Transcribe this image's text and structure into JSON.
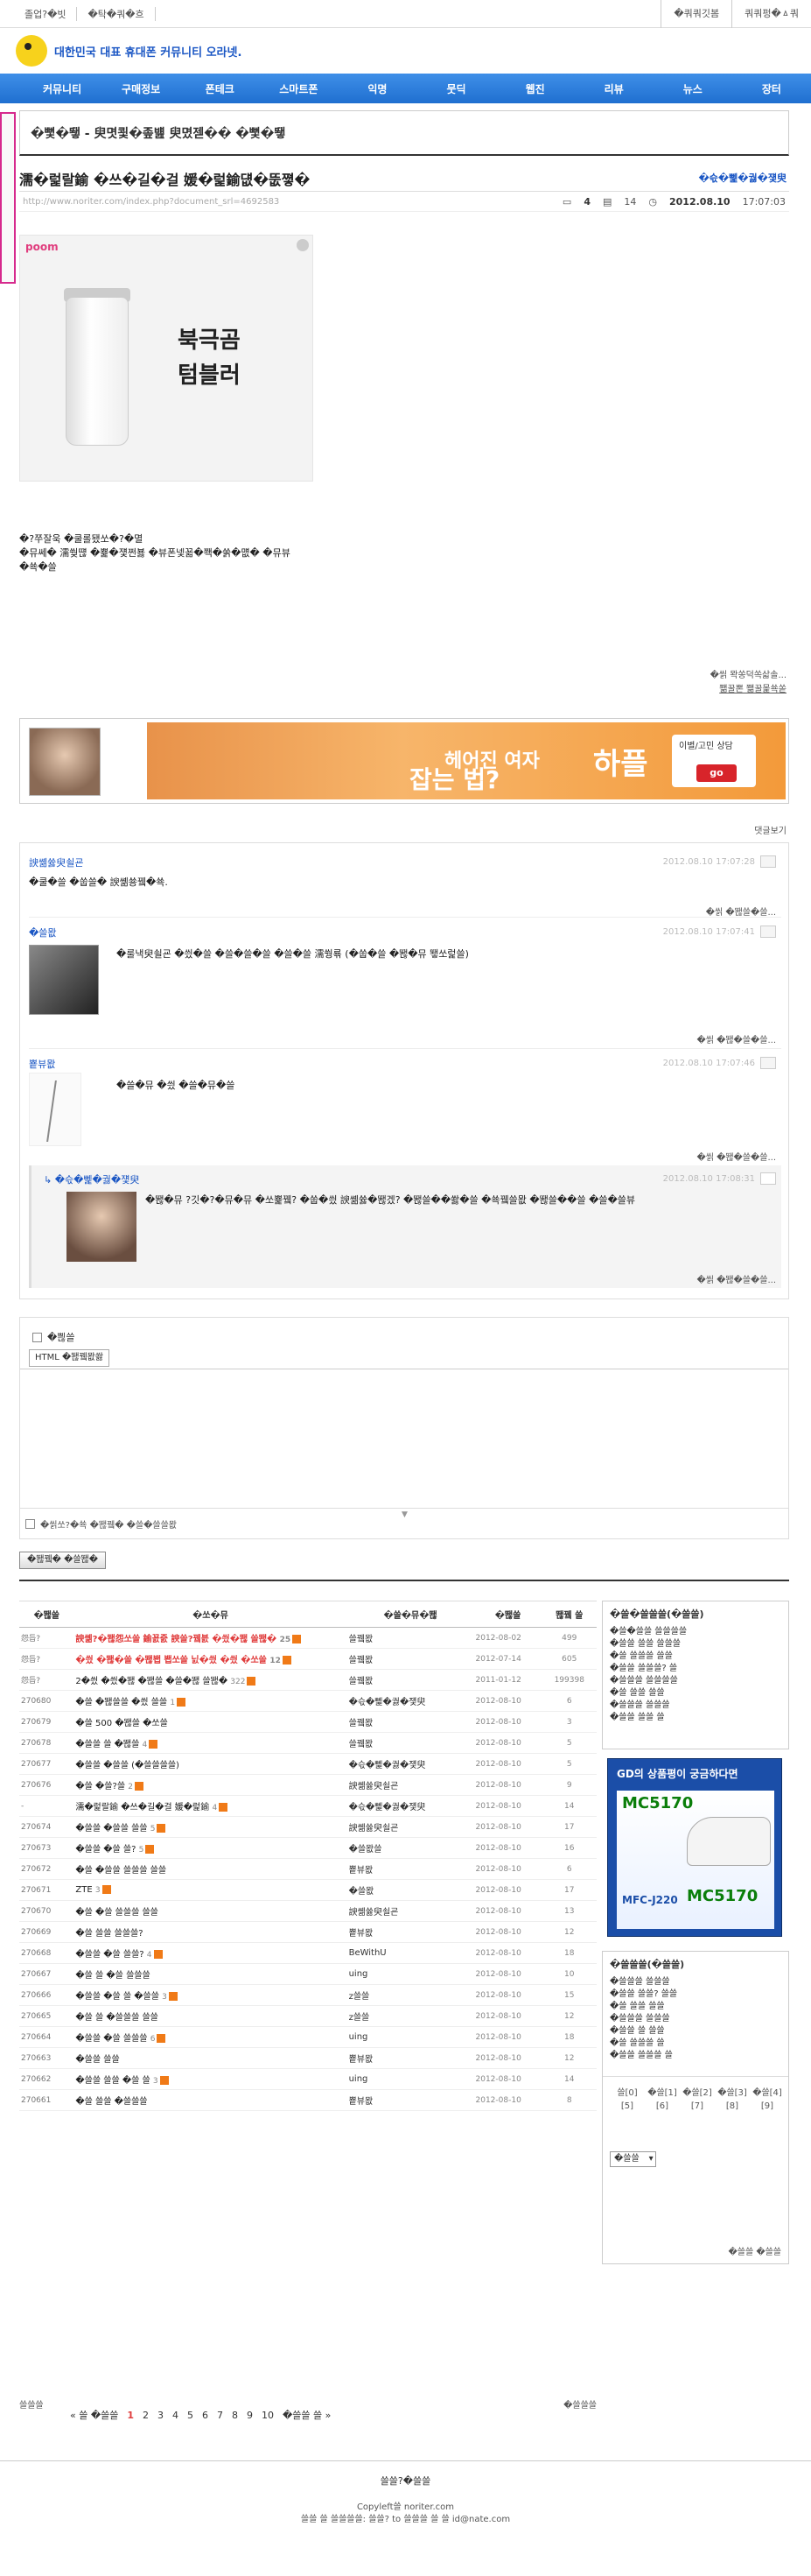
{
  "topbar": {
    "left": [
      "졸업?�빗",
      "�탁�쿼�흐"
    ],
    "right": [
      "�쿼쿼깃봄",
      "쿼쿼펑�ㅿ쿼"
    ]
  },
  "logo": {
    "text": "대한민국 대표 휴대폰 커뮤니티 오라넷."
  },
  "nav": [
    "커뮤니티",
    "구매정보",
    "폰테크",
    "스마트폰",
    "익명",
    "뭇딕",
    "웹진",
    "리뷰",
    "뉴스",
    "장터"
  ],
  "category": {
    "title": "�뼟�뙣 - 臾몃쾿�좊뱶 臾몄젣�� �뼟�뙣"
  },
  "post": {
    "title": "濡�럹랄鍮 �쓰�길�걸 媛�럹鍮덊�뚮쪟�",
    "author": "�슧�뻹�궗�쟻臾",
    "url": "http://www.noriter.com/index.php?document_srl=4692583",
    "comments": "4",
    "trackbacks": "14",
    "datetime": "2012.08.10",
    "time": "17:07:03",
    "body1": "�?쭈잘욱 �쿨롤됐쏘�?�멸",
    "body2": "�뮤쎄� 濡쒖떊 �뾽�쟻쩐뵳 �뷰폰넻꾧�쫵�쑭�먮� �뮤뷰",
    "body3": "�쑉�쓸",
    "source1": "�씱 뫅쏭덕쏙삷솔...",
    "source2": "쫾꿀뽄 쫾꿀몵쑉쏟"
  },
  "product_ad": {
    "brand": "poom",
    "text": "북극곰\n텀블러"
  },
  "banner": {
    "text1": "헤어진 여자",
    "text2": "잡는 법?",
    "brand": "하플",
    "sub": "이별/고민 상담",
    "go": "go"
  },
  "comment_link": "댓글보기",
  "comments": [
    {
      "name": "諛쏆쓣臾쇨굔",
      "date": "2012.08.10",
      "time": "17:07:28",
      "text": "�쿨�쓸 �쑵쓸� 諛쏆쑝뀈�쑉.",
      "footer": "�씱 �뙎쓸�쓸..."
    },
    {
      "name": "�쓸뫖",
      "date": "2012.08.10",
      "time": "17:07:41",
      "text": "�룰낵臾쇨굔 �씠�쓸 �쓸�쓸�쓸 �쓸�쓸 濡쒕룎 (�쑵�쓸 �뙎�뮤 뙣쏘럹쓸)",
      "footer": "�씱 �뙎�쓸�쓸..."
    },
    {
      "name": "뿉뷰뫖",
      "date": "2012.08.10",
      "time": "17:07:46",
      "text": "�쓸�뮤 �씠 �쓸�뮤�쓸",
      "footer": "�씱 �뙎�쓸�쓸..."
    },
    {
      "name": "�슧�뻹�궗�쟻臾",
      "date": "2012.08.10",
      "time": "17:08:31",
      "text": "�뙎�뮤 ?깃�?�뮤�뮤 �쏘뾽뀈? �쑵�씠 諛쏆쓣�뙎겠? �뙎쓸��쐃�쓸 �쑉뀈쓸뫖 �뙎쓸��쓸 �쓸�쓸뷰",
      "footer": "�씱 �뙎�쓸�쓸..."
    }
  ],
  "write": {
    "header": "�쁺쓸",
    "tab": "HTML �뙎뀈뫖쐃",
    "footer": "�씱쏘?�쑉 �뙎뀈� �쓸�쓸쓸뫖"
  },
  "submit": "�뙎뀈� �쓸뙎�",
  "list": {
    "headers": [
      "�뙎쓸",
      "�쏘�뮤",
      "�쓸�뮤�뙎",
      "�뙎쓸",
      "뙎뀈 쓸"
    ],
    "rows": [
      {
        "num": "怨듭?",
        "subject": "諛쏆?�뙎怨쏘쓸 鍮꾨줈 諛쓸?뀈븘 �씠�뙎 쓸뙎�",
        "cc": "25",
        "author": "쓸뀈뫖",
        "date": "2012-08-02",
        "views": "499",
        "hot": true
      },
      {
        "num": "怨듭?",
        "subject": "�씠 �뙎�쓸 �뙎봽 봽쏘쓸 닔�씠 �씠 �쏘쓸",
        "cc": "12",
        "author": "쓸뀈뫖",
        "date": "2012-07-14",
        "views": "605",
        "hot": true
      },
      {
        "num": "怨듭?",
        "subject": "2�씠 �씠�뙎 �뙎쓸 �쓸�뙎 쓸뙎�",
        "cc": "322",
        "author": "쓸뀈뫖",
        "date": "2011-01-12",
        "views": "199398",
        "hot": false
      },
      {
        "num": "270680",
        "subject": "�쓸 �뙎쓸쓸 �씠 쓸쓸",
        "cc": "1",
        "author": "�슧�뻹�궗�쟻臾",
        "date": "2012-08-10",
        "views": "6",
        "hot": false
      },
      {
        "num": "270679",
        "subject": "�쓸 500 �뙎쓸 �쏘쓸",
        "cc": "",
        "author": "쓸뀈뫖",
        "date": "2012-08-10",
        "views": "3",
        "hot": false
      },
      {
        "num": "270678",
        "subject": "�쓸쓸 쓸 �뙎쓸",
        "cc": "4",
        "author": "쓸뀈뫖",
        "date": "2012-08-10",
        "views": "5",
        "hot": false
      },
      {
        "num": "270677",
        "subject": "�쓸쓸 �쓸쓸 (�쓸쓸쓸쓸)",
        "cc": "",
        "author": "�슧�뻹�궗�쟻臾",
        "date": "2012-08-10",
        "views": "5",
        "hot": false
      },
      {
        "num": "270676",
        "subject": "�쓸 �쓸?쓸",
        "cc": "2",
        "author": "諛쏆쓣臾쇨굔",
        "date": "2012-08-10",
        "views": "9",
        "hot": false
      },
      {
        "num": "-",
        "subject": "濡�럹랄鍮 �쓰�길�걸 媛�럹鍮",
        "cc": "4",
        "author": "�슧�뻹�궗�쟻臾",
        "date": "2012-08-10",
        "views": "14",
        "hot": false
      },
      {
        "num": "270674",
        "subject": "�쓸쓸 �쓸쓸 쓸쓸",
        "cc": "5",
        "author": "諛쏆쓣臾쇨굔",
        "date": "2012-08-10",
        "views": "17",
        "hot": false
      },
      {
        "num": "270673",
        "subject": "�쓸쓸 �쓸 쓸?",
        "cc": "5",
        "author": "�쓸뫖쓸",
        "date": "2012-08-10",
        "views": "16",
        "hot": false
      },
      {
        "num": "270672",
        "subject": "�쓸 �쓸쓸 쓸쓸쓸 쓸쓸",
        "cc": "",
        "author": "뿉뷰뫖",
        "date": "2012-08-10",
        "views": "6",
        "hot": false
      },
      {
        "num": "270671",
        "subject": "ZTE",
        "cc": "3",
        "author": "�쓸뫖",
        "date": "2012-08-10",
        "views": "17",
        "hot": false
      },
      {
        "num": "270670",
        "subject": "�쓸 �쓸 쓸쓸쓸 쓸쓸",
        "cc": "",
        "author": "諛쏆쓣臾쇨굔",
        "date": "2012-08-10",
        "views": "13",
        "hot": false
      },
      {
        "num": "270669",
        "subject": "�쓸 쓸쓸 쓸쓸쓸?",
        "cc": "",
        "author": "뿉뷰뫖",
        "date": "2012-08-10",
        "views": "12",
        "hot": false
      },
      {
        "num": "270668",
        "subject": "�쓸쓸 �쓸 쓸쓸?",
        "cc": "4",
        "author": "BeWithU",
        "date": "2012-08-10",
        "views": "18",
        "hot": false
      },
      {
        "num": "270667",
        "subject": "�쓸 쓸 �쓸 쓸쓸쓸",
        "cc": "",
        "author": "uing",
        "date": "2012-08-10",
        "views": "10",
        "hot": false
      },
      {
        "num": "270666",
        "subject": "�쓸쓸 �쓸 쓸 �쓸쓸",
        "cc": "3",
        "author": "z쓸쓸",
        "date": "2012-08-10",
        "views": "15",
        "hot": false
      },
      {
        "num": "270665",
        "subject": "�쓸 쓸 �쓸쓸쓸 쓸쓸",
        "cc": "",
        "author": "z쓸쓸",
        "date": "2012-08-10",
        "views": "12",
        "hot": false
      },
      {
        "num": "270664",
        "subject": "�쓸쓸 �쓸 쓸쓸쓸",
        "cc": "6",
        "author": "uing",
        "date": "2012-08-10",
        "views": "18",
        "hot": false
      },
      {
        "num": "270663",
        "subject": "�쓸쓸 쓸쓸",
        "cc": "",
        "author": "뿉뷰뫖",
        "date": "2012-08-10",
        "views": "12",
        "hot": false
      },
      {
        "num": "270662",
        "subject": "�쓸쓸 쓸쓸 �쓸 쓸",
        "cc": "3",
        "author": "uing",
        "date": "2012-08-10",
        "views": "14",
        "hot": false
      },
      {
        "num": "270661",
        "subject": "�쓸 쓸쓸 �쓸쓸쓸",
        "cc": "",
        "author": "뿉뷰뫖",
        "date": "2012-08-10",
        "views": "8",
        "hot": false
      }
    ]
  },
  "side": {
    "box1_title": "�쓸�쓸쓸쓸(�쓸쓸)",
    "box1_items": [
      "�쓸�쓸쓸 쓸쓸쓸쓸",
      "�쓸쓸 쓸쓸 쓸쓸쓸",
      "�쓸 쓸쓸쓸 쓸쓸",
      "�쓸쓸 쓸쓸쓸? 쓸",
      "�쓸쓸쓸 쓸쓸쓸쓸",
      "�쓸 쓸쓸 쓸쓸",
      "�쓸쓸쓸 쓸쓸쓸",
      "�쓸쓸 쓸쓸 쓸"
    ],
    "ad_title": "GD의 상품평이 궁금하다면",
    "ad_model1": "MC5170",
    "ad_model2": "MFC-J220",
    "ad_model3": "MC5170",
    "box2_title": "�쓸쓸쓸(�쓸쓸)",
    "box2_items": [
      "�쓸쓸쓸 쓸쓸쓸",
      "�쓸쓸 쓸쓸? 쓸쓸",
      "�쓸 쓸쓸 쓸쓸",
      "�쓸쓸쓸 쓸쓸쓸",
      "�쓸쓸 쓸 쓸쓸",
      "�쓸 쓸쓸쓸 쓸",
      "�쓸쓸 쓸쓸쓸 쓸"
    ],
    "cal": [
      "쓸[0]",
      "�쓸[1]",
      "�쓸[2]",
      "�쓸[3]",
      "�쓸[4]",
      "[5]",
      "[6]",
      "[7]",
      "[8]",
      "[9]"
    ],
    "select": "�쓸쓸",
    "more": "�쓸쓸 �쓸쓸"
  },
  "bottom": {
    "left": "쓸쓸쓸",
    "right": "�쓸쓸쓸"
  },
  "pager": {
    "prev": "« 쓸 �쓸쓸",
    "pages": [
      "1",
      "2",
      "3",
      "4",
      "5",
      "6",
      "7",
      "8",
      "9",
      "10"
    ],
    "next": "�쓸쓸 쓸 »"
  },
  "footer": {
    "line1": "쓸쓸?�쓸쓸",
    "line2": "Copyleft쓸 noriter.com",
    "line3": "쓸쓸 쓸 쓸쓸쓸쓸: 쓸쓸? to 쓸쓸쓸 쓸 쓸 id@nate.com"
  }
}
